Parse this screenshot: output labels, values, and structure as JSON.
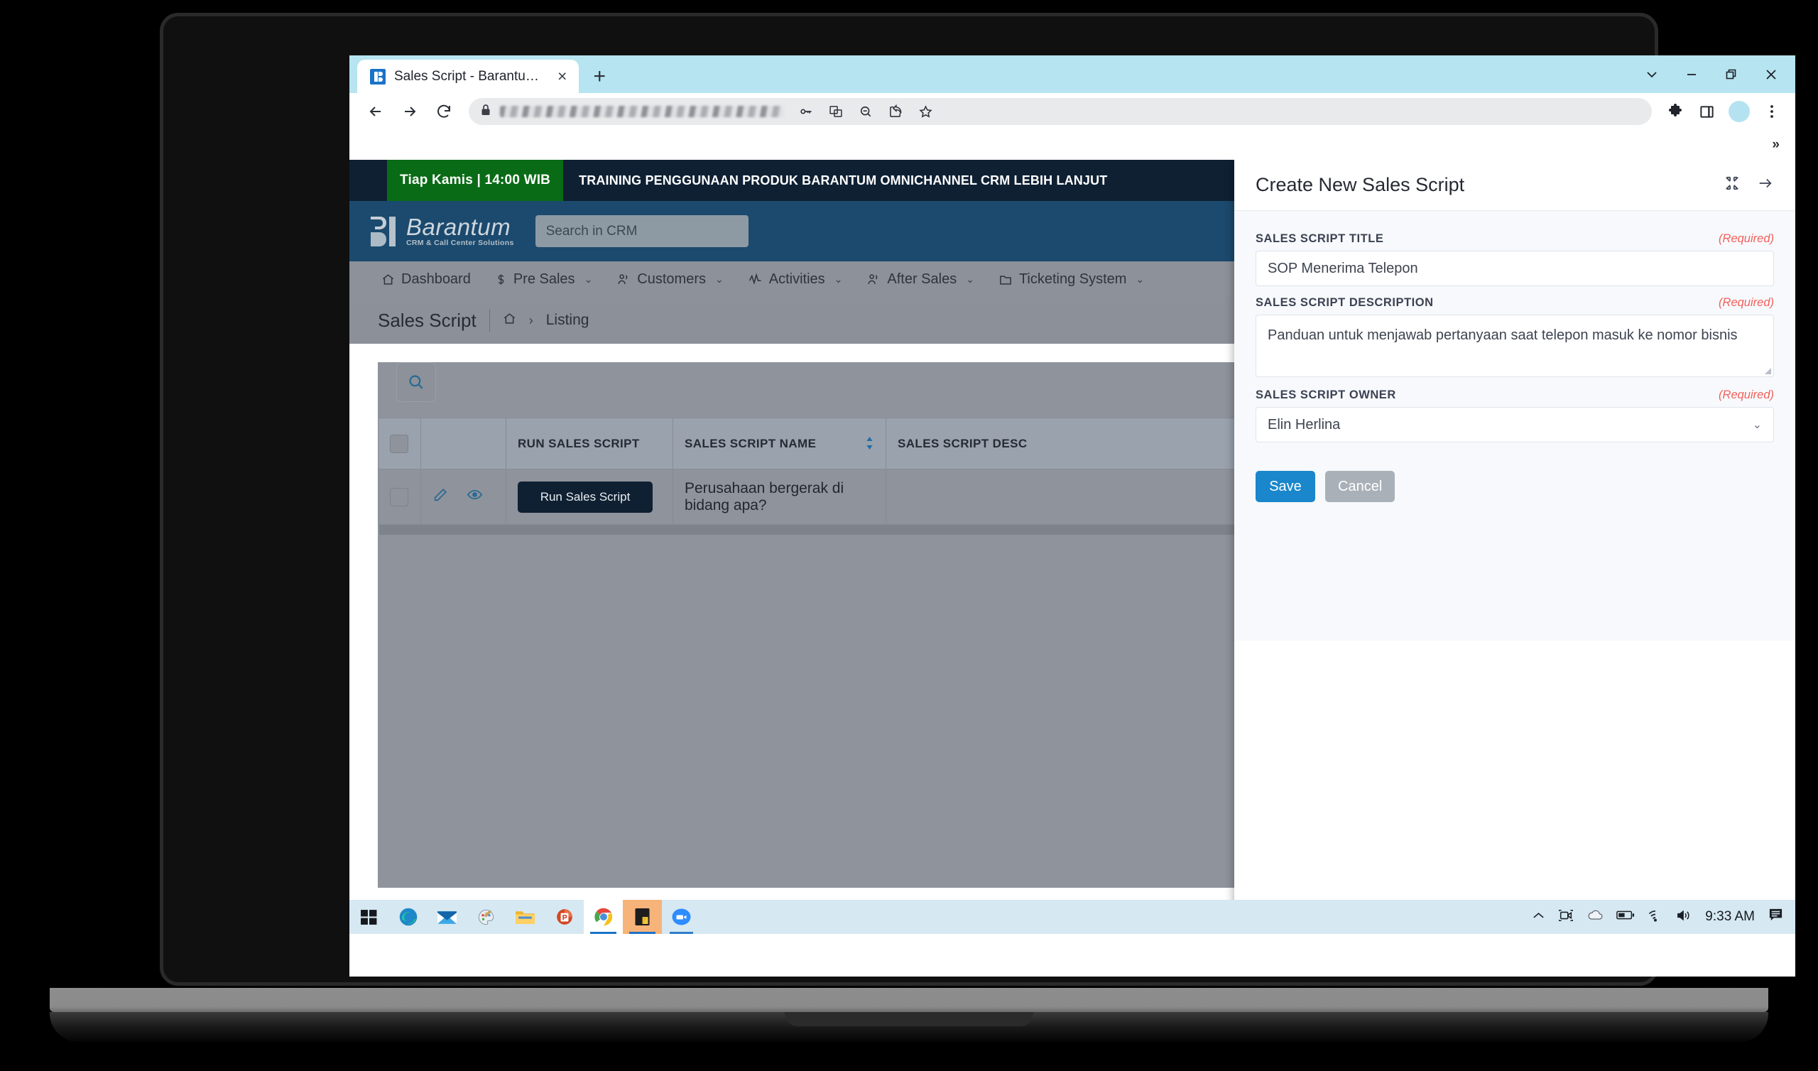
{
  "device": {
    "label": "MacBook Pro"
  },
  "browser": {
    "tab": {
      "title": "Sales Script - Barantum CRM",
      "favicon": "barantum-favicon",
      "close": "×"
    },
    "new_tab_label": "+",
    "window_controls": [
      "tab-search-chevron",
      "minimize",
      "restore",
      "close"
    ],
    "toolbar": {
      "back": "back-arrow-icon",
      "forward": "forward-arrow-icon",
      "reload": "reload-icon",
      "lock": "lock-icon",
      "url_redacted": "",
      "icons": [
        "key-icon",
        "translate-icon",
        "zoom-out-icon",
        "share-icon",
        "bookmark-star-icon",
        "extensions-puzzle-icon",
        "side-panel-icon",
        "profile-avatar",
        "kebab-menu-icon"
      ]
    },
    "bookmarks_overflow": "»"
  },
  "promo": {
    "badge": "Tiap Kamis | 14:00 WIB",
    "text": "TRAINING PENGGUNAAN PRODUK BARANTUM OMNICHANNEL CRM LEBIH LANJUT"
  },
  "brand": {
    "name": "Barantum",
    "tagline": "CRM & Call Center Solutions",
    "search_placeholder": "Search in CRM"
  },
  "nav": {
    "items": [
      {
        "label": "Dashboard",
        "icon": "home-icon",
        "caret": false
      },
      {
        "label": "Pre Sales",
        "icon": "dollar-icon",
        "caret": true
      },
      {
        "label": "Customers",
        "icon": "people-icon",
        "caret": true
      },
      {
        "label": "Activities",
        "icon": "pulse-icon",
        "caret": true
      },
      {
        "label": "After Sales",
        "icon": "people-icon",
        "caret": true
      },
      {
        "label": "Ticketing System",
        "icon": "folder-icon",
        "caret": true
      }
    ],
    "caret_glyph": "⌄"
  },
  "breadcrumb": {
    "title": "Sales Script",
    "home_icon": "home-icon",
    "separator": "›",
    "current": "Listing"
  },
  "grid": {
    "search_icon": "search-icon",
    "columns": [
      {
        "label": "",
        "sortable": false
      },
      {
        "label": "",
        "sortable": false
      },
      {
        "label": "RUN SALES SCRIPT",
        "sortable": false
      },
      {
        "label": "SALES SCRIPT NAME",
        "sortable": true
      },
      {
        "label": "SALES SCRIPT DESC",
        "sortable": true
      }
    ],
    "rows": [
      {
        "edit_icon": "pencil-icon",
        "view_icon": "eye-icon",
        "run_label": "Run Sales Script",
        "name": "Perusahaan bergerak di bidang apa?",
        "desc": ""
      }
    ]
  },
  "panel": {
    "title": "Create New Sales Script",
    "collapse_icon": "collapse-icon",
    "close_icon": "arrow-right-icon",
    "required_label": "(Required)",
    "fields": {
      "title": {
        "label": "SALES SCRIPT TITLE",
        "value": "SOP Menerima Telepon"
      },
      "description": {
        "label": "SALES SCRIPT DESCRIPTION",
        "value": "Panduan untuk menjawab pertanyaan saat telepon masuk ke nomor bisnis"
      },
      "owner": {
        "label": "SALES SCRIPT OWNER",
        "value": "Elin Herlina",
        "chevron": "⌄"
      }
    },
    "buttons": {
      "save": "Save",
      "cancel": "Cancel"
    }
  },
  "taskbar": {
    "apps": [
      "windows-start-icon",
      "edge-icon",
      "mail-icon",
      "paint-icon",
      "file-explorer-icon",
      "powerpoint-icon",
      "chrome-icon",
      "sticky-notes-icon",
      "zoom-icon"
    ],
    "tray": [
      "chevron-up-icon",
      "zoom-camera-icon",
      "onedrive-icon",
      "battery-icon",
      "wifi-icon",
      "volume-icon"
    ],
    "clock": "9:33 AM",
    "notification_icon": "notification-icon"
  },
  "colors": {
    "brand_blue": "#1b4a6e",
    "promo_dark": "#0f2033",
    "promo_green": "#0a6b16",
    "accent_blue": "#1a86cb",
    "required_red": "#f2615c",
    "run_button": "#0f2033"
  }
}
